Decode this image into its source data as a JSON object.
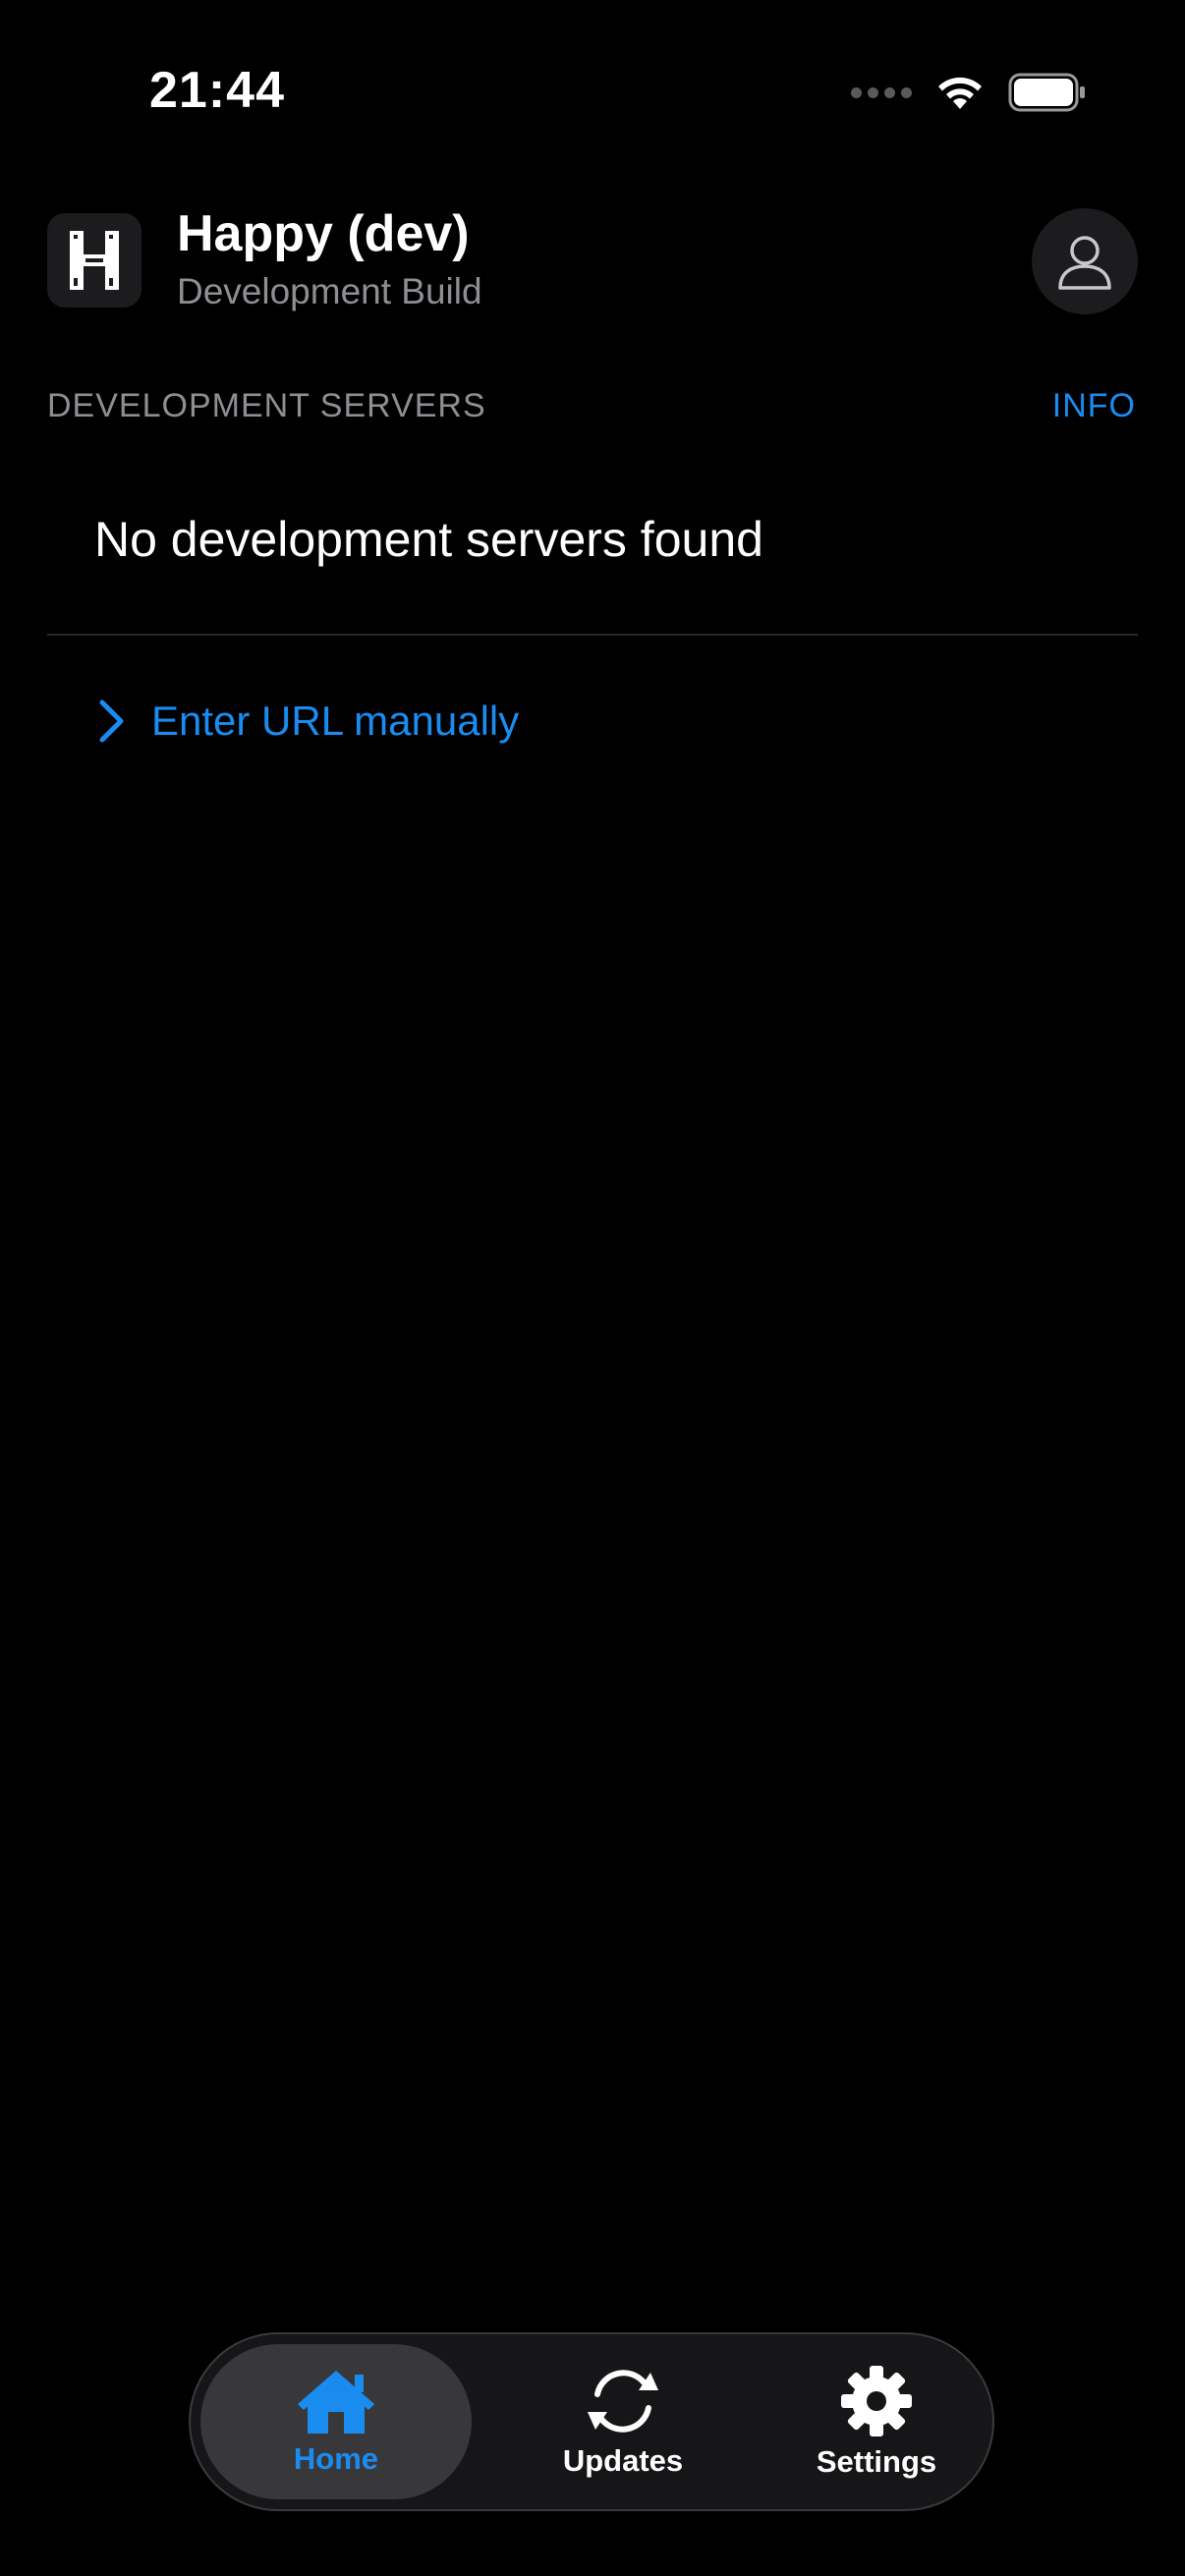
{
  "status_bar": {
    "time": "21:44"
  },
  "header": {
    "title": "Happy (dev)",
    "subtitle": "Development Build",
    "logo_icon": "happy-logo-icon",
    "profile_icon": "person-icon"
  },
  "section": {
    "title": "DEVELOPMENT SERVERS",
    "info_label": "INFO",
    "empty_message": "No development servers found",
    "enter_url_label": "Enter URL manually"
  },
  "tab_bar": {
    "tabs": [
      {
        "label": "Home",
        "icon": "home-icon",
        "active": true
      },
      {
        "label": "Updates",
        "icon": "refresh-icon",
        "active": false
      },
      {
        "label": "Settings",
        "icon": "gear-icon",
        "active": false
      }
    ]
  },
  "colors": {
    "background": "#000000",
    "accent": "#1a8cf0",
    "secondary_text": "#8e8e93",
    "surface": "#1c1c1e"
  }
}
